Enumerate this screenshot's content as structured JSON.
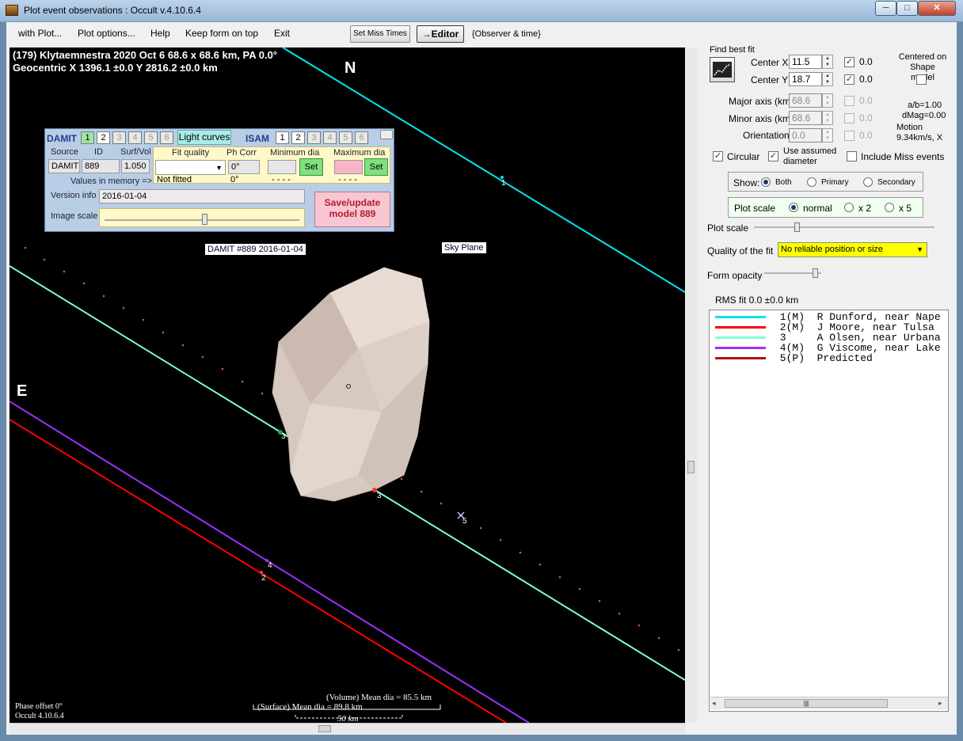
{
  "window": {
    "title": "Plot event observations : Occult v.4.10.6.4",
    "minimize": "─",
    "maximize": "□",
    "close": "✕"
  },
  "menu": {
    "items": [
      "with Plot...",
      "Plot options...",
      "Help",
      "Keep form on top",
      "Exit"
    ],
    "set_miss_times": "Set Miss Times",
    "editor": "→Editor",
    "observer_time": "{Observer & time}"
  },
  "plot": {
    "header_line1": "(179) Klytaemnestra  2020 Oct 6   68.6 x 68.6 km,  PA 0.0°",
    "header_line2": "Geocentric  X  1396.1 ±0.0  Y 2816.2 ±0.0 km",
    "north": "N",
    "east": "E",
    "damit_label": "DAMIT #889 2016-01-04",
    "sky_plane_label": "Sky Plane",
    "phase_offset": "Phase offset 0°",
    "version": "Occult 4.10.6.4",
    "volume_mean": "(Volume) Mean dia = 85.5 km",
    "surface_mean": "(Surface) Mean dia = 89.8 km",
    "scale_bar": "50 km",
    "chord_labels": [
      "1",
      "2",
      "3",
      "3",
      "4",
      "5"
    ]
  },
  "damit": {
    "damit_title": "DAMIT",
    "damit_numbers": [
      "1",
      "2",
      "3",
      "4",
      "5",
      "6"
    ],
    "light_curves": "Light curves",
    "isam_title": "ISAM",
    "isam_numbers": [
      "1",
      "2",
      "3",
      "4",
      "5",
      "6"
    ],
    "col_source": "Source",
    "col_id": "ID",
    "col_surfvol": "Surf/Vol",
    "col_fit_quality": "Fit quality",
    "col_ph_corr": "Ph Corr",
    "col_min_dia": "Minimum dia",
    "col_max_dia": "Maximum dia",
    "source": "DAMIT",
    "id": "889",
    "surfvol": "1.050",
    "fit_quality_value": "",
    "ph_corr": "0°",
    "values_in_memory": "Values in memory =>",
    "not_fitted": "Not fitted",
    "ph_corr_mem": "0°",
    "min_dia_mem": "- - - -",
    "max_dia_mem": "- - - -",
    "set1": "Set",
    "set2": "Set",
    "version_info_label": "Version info",
    "version_info": "2016-01-04",
    "image_scale_label": "Image scale",
    "save_update": "Save/update model 889"
  },
  "fit": {
    "find_best_fit": "Find best fit",
    "center_x_label": "Center X",
    "center_x": "11.5",
    "center_x_check": "0.0",
    "center_y_label": "Center Y",
    "center_y": "18.7",
    "center_y_check": "0.0",
    "centered_on": "Centered on Shape model",
    "major_label": "Major axis (km)",
    "major": "68.6",
    "major_check": "0.0",
    "minor_label": "Minor axis (km)",
    "minor": "68.6",
    "minor_check": "0.0",
    "orient_label": "Orientation",
    "orient": "0.0",
    "orient_check": "0.0",
    "ab": "a/b=1.00",
    "dmag": "dMag=0.00",
    "motion_label": "Motion",
    "motion": "9.34km/s, X",
    "circular": "Circular",
    "use_assumed": "Use assumed diameter",
    "include_miss": "Include Miss events",
    "show_label": "Show:",
    "show_both": "Both",
    "show_primary": "Primary",
    "show_secondary": "Secondary",
    "plot_scale_label": "Plot scale",
    "scale_normal": "normal",
    "scale_x2": "x 2",
    "scale_x5": "x 5",
    "plot_scale_slider_label": "Plot scale",
    "quality_label": "Quality of the fit",
    "quality_value": "No reliable position or size",
    "form_opacity_label": "Form opacity",
    "rms": "RMS fit 0.0 ±0.0 km"
  },
  "legend": {
    "rows": [
      {
        "text": " 1(M)  R Dunford, near Nape",
        "color": "#00e5ee"
      },
      {
        "text": " 2(M)  J Moore, near Tulsa",
        "color": "#ff0000"
      },
      {
        "text": " 3     A Olsen, near Urbana",
        "color": "#7fffd4"
      },
      {
        "text": " 4(M)  G Viscome, near Lake",
        "color": "#9b30ff"
      },
      {
        "text": " 5(P)  Predicted",
        "color": "#b01010"
      }
    ]
  },
  "colors": {
    "chord_cyan": "#00e5ee",
    "chord_red": "#ff0000",
    "chord_aqua": "#7fffd4",
    "chord_purple": "#9b30ff",
    "quality_bg": "#ffff00"
  }
}
